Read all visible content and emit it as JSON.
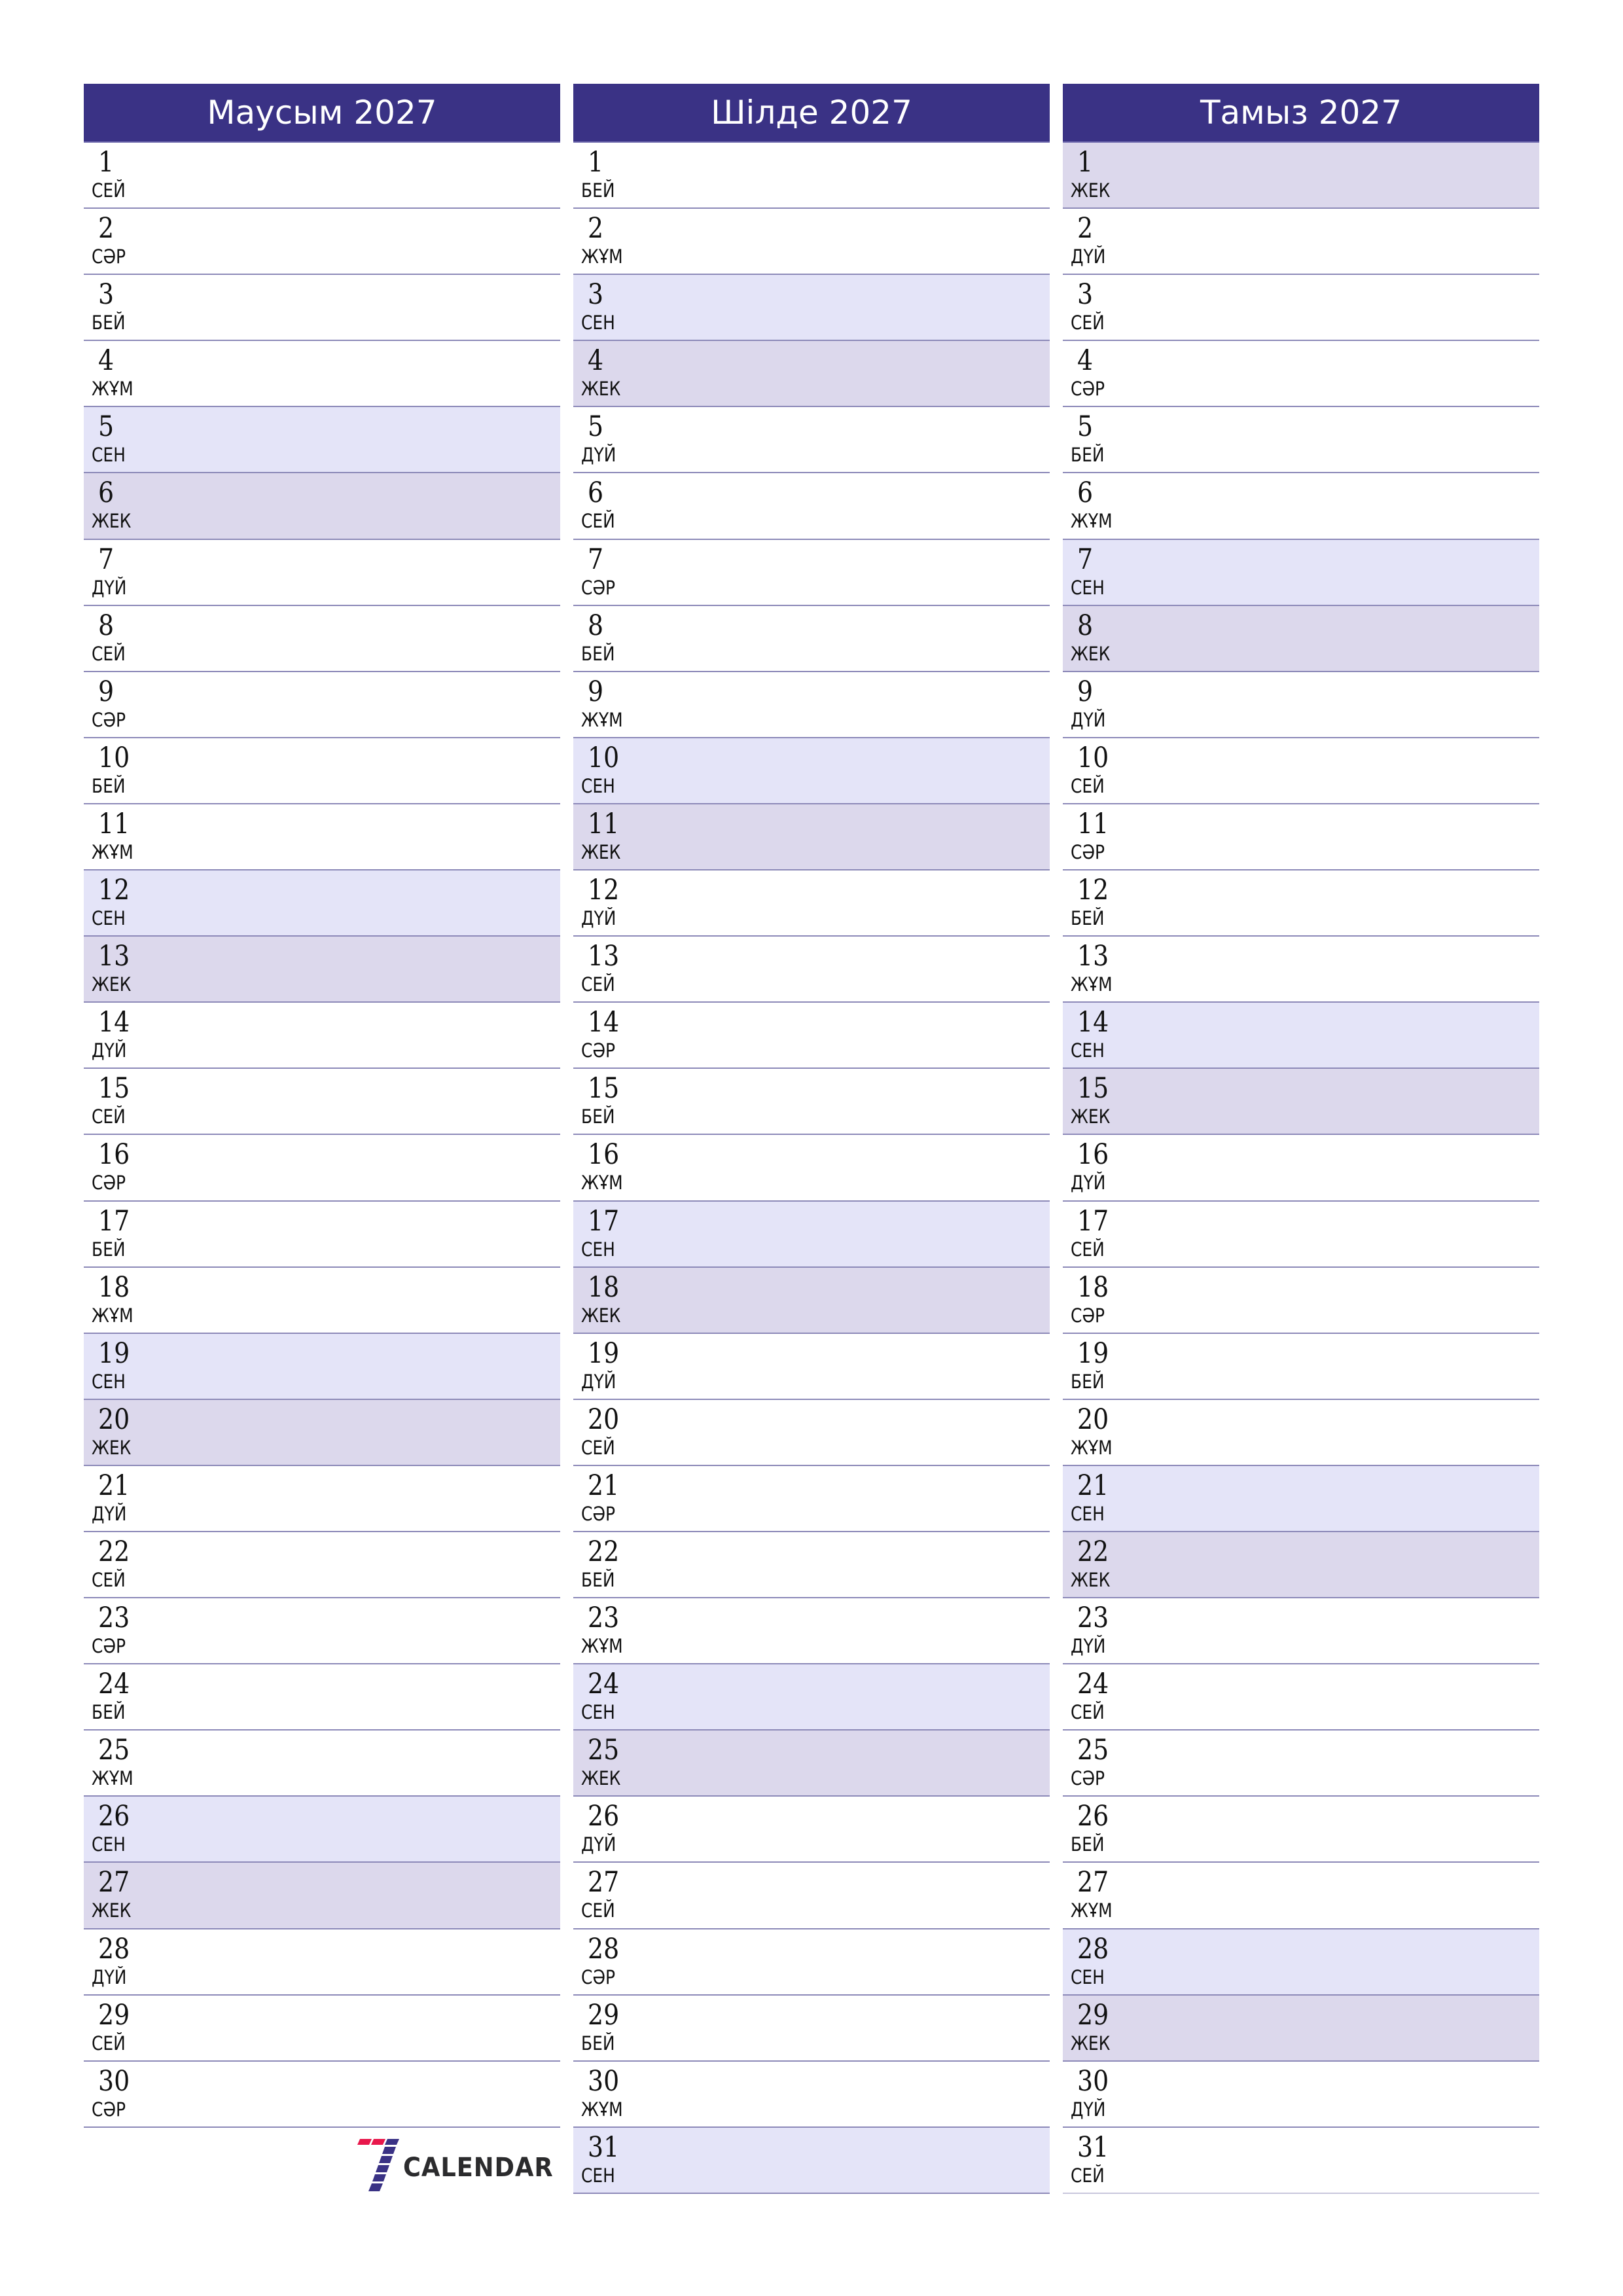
{
  "colors": {
    "header_bg": "#3a3285",
    "saturday_bg": "#e4e4f8",
    "sunday_bg": "#dcd8ec",
    "row_line": "#8c89b8",
    "logo_red": "#e8174b",
    "logo_blue": "#3a3285"
  },
  "months": [
    {
      "title": "Маусым 2027",
      "days": [
        {
          "n": "1",
          "wd": "СЕЙ"
        },
        {
          "n": "2",
          "wd": "СӘР"
        },
        {
          "n": "3",
          "wd": "БЕЙ"
        },
        {
          "n": "4",
          "wd": "ЖҰМ"
        },
        {
          "n": "5",
          "wd": "СЕН"
        },
        {
          "n": "6",
          "wd": "ЖЕК"
        },
        {
          "n": "7",
          "wd": "ДҮЙ"
        },
        {
          "n": "8",
          "wd": "СЕЙ"
        },
        {
          "n": "9",
          "wd": "СӘР"
        },
        {
          "n": "10",
          "wd": "БЕЙ"
        },
        {
          "n": "11",
          "wd": "ЖҰМ"
        },
        {
          "n": "12",
          "wd": "СЕН"
        },
        {
          "n": "13",
          "wd": "ЖЕК"
        },
        {
          "n": "14",
          "wd": "ДҮЙ"
        },
        {
          "n": "15",
          "wd": "СЕЙ"
        },
        {
          "n": "16",
          "wd": "СӘР"
        },
        {
          "n": "17",
          "wd": "БЕЙ"
        },
        {
          "n": "18",
          "wd": "ЖҰМ"
        },
        {
          "n": "19",
          "wd": "СЕН"
        },
        {
          "n": "20",
          "wd": "ЖЕК"
        },
        {
          "n": "21",
          "wd": "ДҮЙ"
        },
        {
          "n": "22",
          "wd": "СЕЙ"
        },
        {
          "n": "23",
          "wd": "СӘР"
        },
        {
          "n": "24",
          "wd": "БЕЙ"
        },
        {
          "n": "25",
          "wd": "ЖҰМ"
        },
        {
          "n": "26",
          "wd": "СЕН"
        },
        {
          "n": "27",
          "wd": "ЖЕК"
        },
        {
          "n": "28",
          "wd": "ДҮЙ"
        },
        {
          "n": "29",
          "wd": "СЕЙ"
        },
        {
          "n": "30",
          "wd": "СӘР"
        }
      ]
    },
    {
      "title": "Шілде 2027",
      "days": [
        {
          "n": "1",
          "wd": "БЕЙ"
        },
        {
          "n": "2",
          "wd": "ЖҰМ"
        },
        {
          "n": "3",
          "wd": "СЕН"
        },
        {
          "n": "4",
          "wd": "ЖЕК"
        },
        {
          "n": "5",
          "wd": "ДҮЙ"
        },
        {
          "n": "6",
          "wd": "СЕЙ"
        },
        {
          "n": "7",
          "wd": "СӘР"
        },
        {
          "n": "8",
          "wd": "БЕЙ"
        },
        {
          "n": "9",
          "wd": "ЖҰМ"
        },
        {
          "n": "10",
          "wd": "СЕН"
        },
        {
          "n": "11",
          "wd": "ЖЕК"
        },
        {
          "n": "12",
          "wd": "ДҮЙ"
        },
        {
          "n": "13",
          "wd": "СЕЙ"
        },
        {
          "n": "14",
          "wd": "СӘР"
        },
        {
          "n": "15",
          "wd": "БЕЙ"
        },
        {
          "n": "16",
          "wd": "ЖҰМ"
        },
        {
          "n": "17",
          "wd": "СЕН"
        },
        {
          "n": "18",
          "wd": "ЖЕК"
        },
        {
          "n": "19",
          "wd": "ДҮЙ"
        },
        {
          "n": "20",
          "wd": "СЕЙ"
        },
        {
          "n": "21",
          "wd": "СӘР"
        },
        {
          "n": "22",
          "wd": "БЕЙ"
        },
        {
          "n": "23",
          "wd": "ЖҰМ"
        },
        {
          "n": "24",
          "wd": "СЕН"
        },
        {
          "n": "25",
          "wd": "ЖЕК"
        },
        {
          "n": "26",
          "wd": "ДҮЙ"
        },
        {
          "n": "27",
          "wd": "СЕЙ"
        },
        {
          "n": "28",
          "wd": "СӘР"
        },
        {
          "n": "29",
          "wd": "БЕЙ"
        },
        {
          "n": "30",
          "wd": "ЖҰМ"
        },
        {
          "n": "31",
          "wd": "СЕН"
        }
      ]
    },
    {
      "title": "Тамыз 2027",
      "days": [
        {
          "n": "1",
          "wd": "ЖЕК"
        },
        {
          "n": "2",
          "wd": "ДҮЙ"
        },
        {
          "n": "3",
          "wd": "СЕЙ"
        },
        {
          "n": "4",
          "wd": "СӘР"
        },
        {
          "n": "5",
          "wd": "БЕЙ"
        },
        {
          "n": "6",
          "wd": "ЖҰМ"
        },
        {
          "n": "7",
          "wd": "СЕН"
        },
        {
          "n": "8",
          "wd": "ЖЕК"
        },
        {
          "n": "9",
          "wd": "ДҮЙ"
        },
        {
          "n": "10",
          "wd": "СЕЙ"
        },
        {
          "n": "11",
          "wd": "СӘР"
        },
        {
          "n": "12",
          "wd": "БЕЙ"
        },
        {
          "n": "13",
          "wd": "ЖҰМ"
        },
        {
          "n": "14",
          "wd": "СЕН"
        },
        {
          "n": "15",
          "wd": "ЖЕК"
        },
        {
          "n": "16",
          "wd": "ДҮЙ"
        },
        {
          "n": "17",
          "wd": "СЕЙ"
        },
        {
          "n": "18",
          "wd": "СӘР"
        },
        {
          "n": "19",
          "wd": "БЕЙ"
        },
        {
          "n": "20",
          "wd": "ЖҰМ"
        },
        {
          "n": "21",
          "wd": "СЕН"
        },
        {
          "n": "22",
          "wd": "ЖЕК"
        },
        {
          "n": "23",
          "wd": "ДҮЙ"
        },
        {
          "n": "24",
          "wd": "СЕЙ"
        },
        {
          "n": "25",
          "wd": "СӘР"
        },
        {
          "n": "26",
          "wd": "БЕЙ"
        },
        {
          "n": "27",
          "wd": "ЖҰМ"
        },
        {
          "n": "28",
          "wd": "СЕН"
        },
        {
          "n": "29",
          "wd": "ЖЕК"
        },
        {
          "n": "30",
          "wd": "ДҮЙ"
        },
        {
          "n": "31",
          "wd": "СЕЙ"
        }
      ]
    }
  ],
  "weekend_labels": {
    "saturday": "СЕН",
    "sunday": "ЖЕК"
  },
  "logo": {
    "text": "CALENDAR",
    "icon": "seven-icon"
  }
}
